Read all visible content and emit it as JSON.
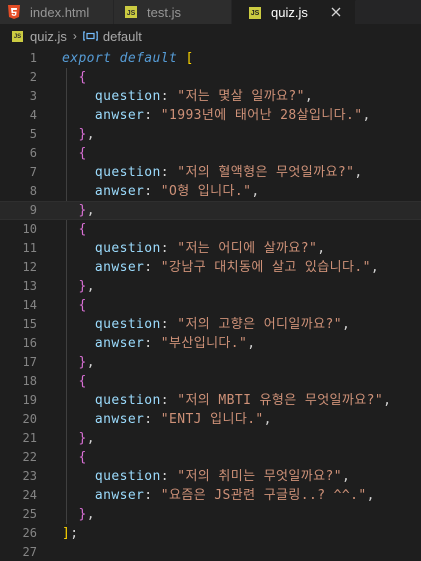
{
  "tabs": [
    {
      "label": "index.html",
      "icon": "html5-icon",
      "active": false
    },
    {
      "label": "test.js",
      "icon": "js-icon",
      "active": false
    },
    {
      "label": "quiz.js",
      "icon": "js-icon",
      "active": true
    }
  ],
  "breadcrumb": {
    "file": "quiz.js",
    "symbol": "default",
    "file_icon_text": "JS"
  },
  "editor": {
    "line_numbers": [
      "1",
      "2",
      "3",
      "4",
      "5",
      "6",
      "7",
      "8",
      "9",
      "10",
      "11",
      "12",
      "13",
      "14",
      "15",
      "16",
      "17",
      "18",
      "19",
      "20",
      "21",
      "22",
      "23",
      "24",
      "25",
      "26",
      "27"
    ],
    "current_line": 9,
    "line1": {
      "kw1": "export",
      "kw2": "default",
      "bracket": "["
    },
    "blocks": [
      {
        "q": "\"저는 몇살 일까요?\"",
        "a": "\"1993년에 태어난 28살입니다.\""
      },
      {
        "q": "\"저의 혈액형은 무엇일까요?\"",
        "a": "\"O형 입니다.\""
      },
      {
        "q": "\"저는 어디에 살까요?\"",
        "a": "\"강남구 대치동에 살고 있습니다.\""
      },
      {
        "q": "\"저의 고향은 어디일까요?\"",
        "a": "\"부산입니다.\""
      },
      {
        "q": "\"저의 MBTI 유형은 무엇일까요?\"",
        "a": "\"ENTJ 입니다.\""
      },
      {
        "q": "\"저의 취미는 무엇일까요?\"",
        "a": "\"요즘은 JS관련 구글링..? ^^.\""
      }
    ],
    "key_question": "question",
    "key_answer": "anwser",
    "close_bracket": "];"
  },
  "colors": {
    "background": "#1e1e1e",
    "keyword": "#569cd6",
    "string": "#ce9178",
    "property": "#9cdcfe",
    "bracket_level1": "#ffd700",
    "bracket_level2": "#da70d6",
    "line_number": "#858585"
  }
}
